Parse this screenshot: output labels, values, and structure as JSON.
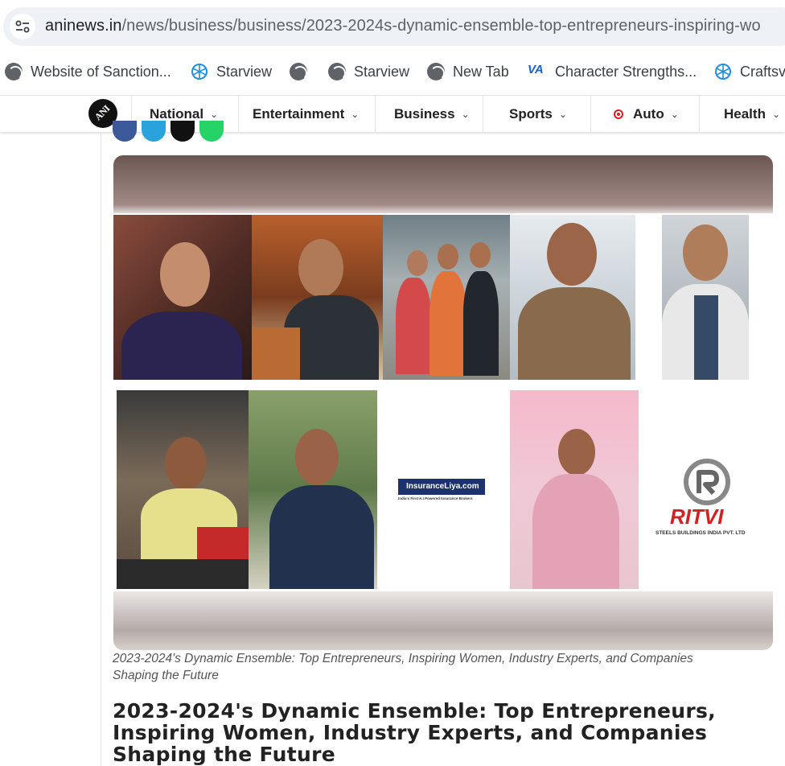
{
  "browser": {
    "address": {
      "host": "aninews.in",
      "path": "/news/business/business/2023-2024s-dynamic-ensemble-top-entrepreneurs-inspiring-wo"
    },
    "bookmarks": [
      {
        "label": "Website of Sanction...",
        "icon": "globe-icon"
      },
      {
        "label": "Starview",
        "icon": "craft-logo-icon"
      },
      {
        "label": "",
        "icon": "globe-icon"
      },
      {
        "label": "Starview",
        "icon": "globe-icon"
      },
      {
        "label": "New Tab",
        "icon": "globe-icon"
      },
      {
        "label": "Character Strengths...",
        "icon": "va-logo-icon"
      },
      {
        "label": "Craftsv",
        "icon": "craft-logo-icon"
      }
    ]
  },
  "site_nav": {
    "logo_text": "ANI",
    "items": [
      {
        "label": "National"
      },
      {
        "label": "Entertainment"
      },
      {
        "label": "Business"
      },
      {
        "label": "Sports"
      },
      {
        "label": "Auto"
      },
      {
        "label": "Health"
      }
    ]
  },
  "article": {
    "image": {
      "brand_insurance": "InsuranceLiya.com",
      "brand_insurance_tagline": "India's First A.I Powered Insurance Brokers",
      "brand_ritvi": "RITVI",
      "brand_ritvi_sub": "STEELS BUILDINGS INDIA PVT. LTD"
    },
    "caption": "2023-2024's Dynamic Ensemble: Top Entrepreneurs, Inspiring Women, Industry Experts, and Companies Shaping the Future",
    "headline": "2023-2024's Dynamic Ensemble: Top Entrepreneurs, Inspiring Women, Industry Experts, and Companies Shaping the Future"
  },
  "colors": {
    "accent_red": "#e41c1c",
    "facebook": "#3b5998",
    "telegram": "#2aa3dd",
    "x": "#111111",
    "whatsapp": "#25d366"
  }
}
